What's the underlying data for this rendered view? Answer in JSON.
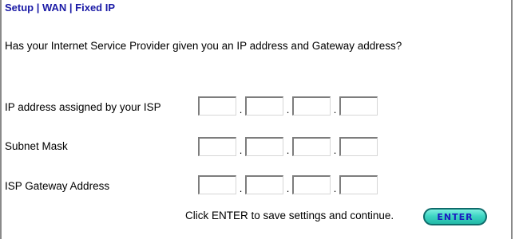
{
  "header": {
    "breadcrumb": "Setup | WAN | Fixed IP"
  },
  "prompt": {
    "question": "Has your Internet Service Provider given you an IP address and Gateway address?"
  },
  "fields": {
    "ip_address": {
      "label": "IP address assigned by your ISP",
      "octets": [
        "",
        "",
        "",
        ""
      ]
    },
    "subnet_mask": {
      "label": "Subnet Mask",
      "octets": [
        "",
        "",
        "",
        ""
      ]
    },
    "gateway": {
      "label": "ISP Gateway Address",
      "octets": [
        "",
        "",
        "",
        ""
      ]
    },
    "separator": "."
  },
  "footer": {
    "instruction": "Click ENTER to save settings and continue.",
    "enter_label": "ENTER"
  },
  "colors": {
    "breadcrumb": "#1a1aa6",
    "enter_button_fill": "#3fd6c4",
    "enter_button_text": "#1c1cc0"
  }
}
